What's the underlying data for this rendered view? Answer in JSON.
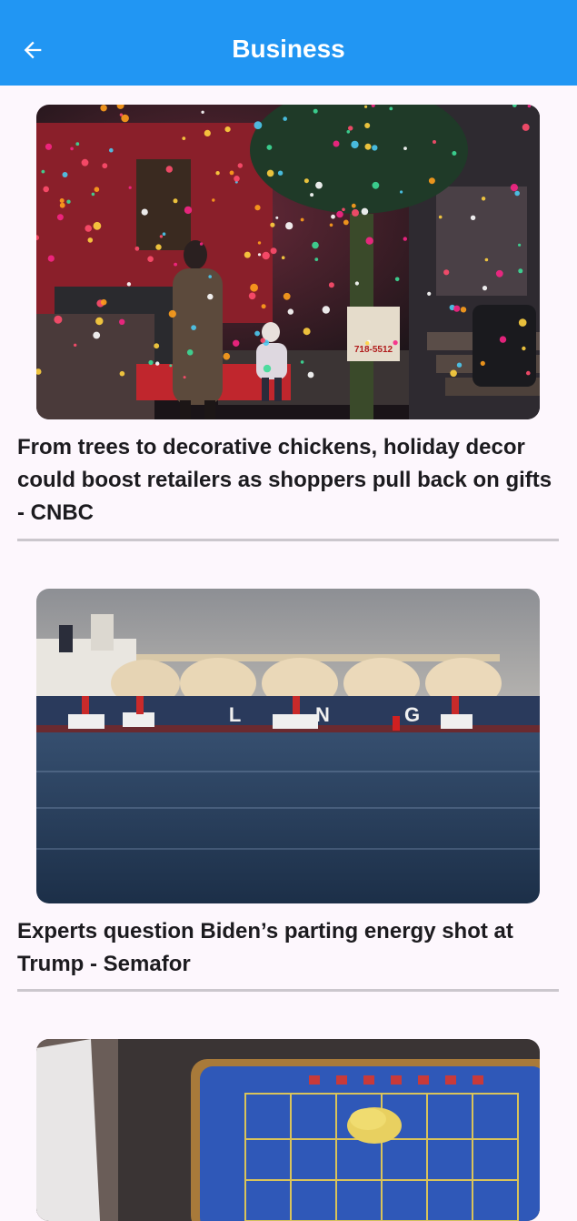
{
  "header": {
    "title": "Business",
    "back_icon": "arrow-back-icon",
    "background_color": "#2196f3"
  },
  "articles": [
    {
      "title": "From trees to decorative chickens, holiday decor could boost retailers as shoppers pull back on gifts - CNBC",
      "image_icon": "holiday-lights-house-photo",
      "image_sign_text": "718-5512"
    },
    {
      "title": "Experts question Biden’s parting energy shot at Trump - Semafor",
      "image_icon": "lng-tanker-photo",
      "image_hull_text": "L N G"
    },
    {
      "title": "",
      "image_icon": "roulette-table-photo"
    }
  ]
}
